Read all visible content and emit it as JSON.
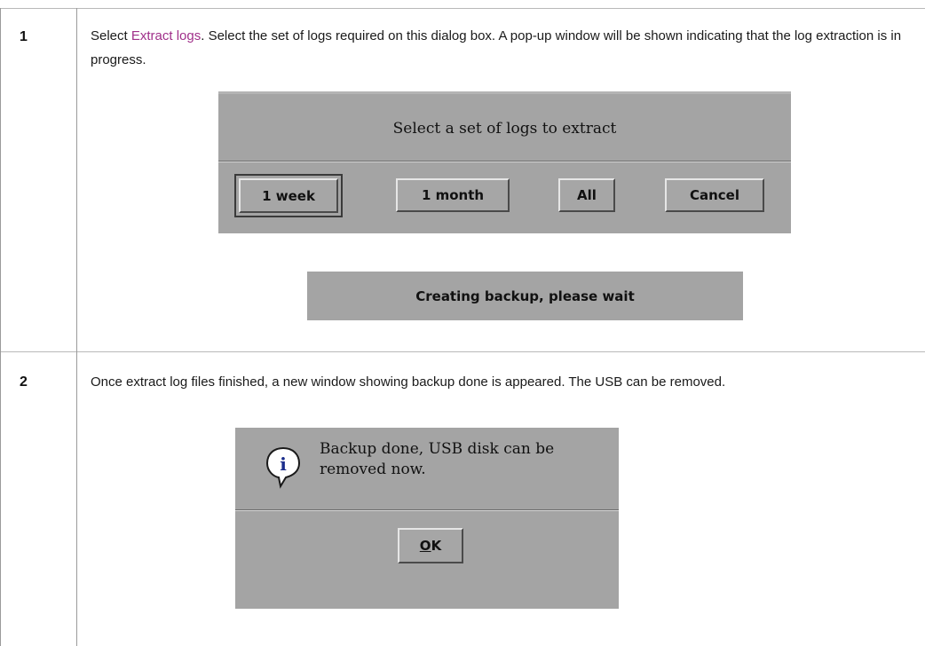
{
  "steps": [
    {
      "number": "1",
      "text_before_link": "Select ",
      "link_text": "Extract logs",
      "text_after_link": ". Select the set of logs required on this dialog box. A pop-up window will be shown indicating that the log extraction is in progress."
    },
    {
      "number": "2",
      "text": "Once extract log files finished, a new window showing backup done is appeared. The USB can be removed."
    }
  ],
  "select_dialog": {
    "prompt": "Select a set of logs to extract",
    "buttons": [
      "1 week",
      "1 month",
      "All",
      "Cancel"
    ]
  },
  "progress_dialog": {
    "message": "Creating backup, please wait"
  },
  "done_dialog": {
    "icon": "info-icon",
    "icon_glyph": "i",
    "message_line1": "Backup done, USB disk can be",
    "message_line2": "removed now.",
    "ok_mnemonic": "O",
    "ok_rest": "K"
  },
  "colors": {
    "link": "#a0308a",
    "dialog_grey": "#a4a4a4"
  }
}
